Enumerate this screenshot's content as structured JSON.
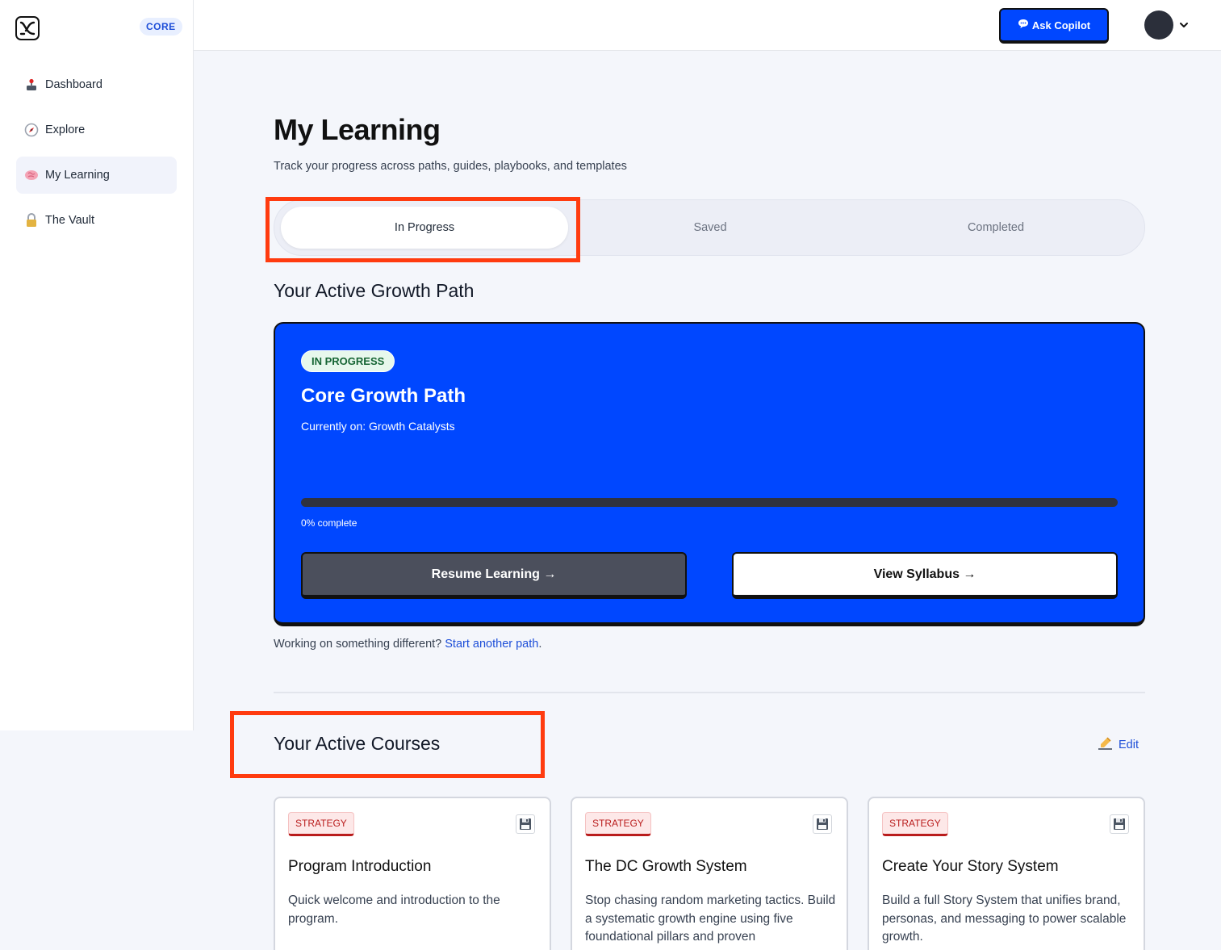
{
  "app": {
    "plan_badge": "CORE"
  },
  "sidebar": {
    "items": [
      {
        "label": "Dashboard",
        "icon": "joystick-icon"
      },
      {
        "label": "Explore",
        "icon": "compass-icon"
      },
      {
        "label": "My Learning",
        "icon": "brain-icon",
        "active": true
      },
      {
        "label": "The Vault",
        "icon": "lock-icon"
      }
    ]
  },
  "topbar": {
    "copilot_label": "Ask Copilot",
    "copilot_icon": "speech-bubble-icon"
  },
  "page": {
    "title": "My Learning",
    "subtitle": "Track your progress across paths, guides, playbooks, and templates"
  },
  "tabs": [
    {
      "label": "In Progress",
      "active": true
    },
    {
      "label": "Saved",
      "active": false
    },
    {
      "label": "Completed",
      "active": false
    }
  ],
  "growth_path": {
    "section_title": "Your Active Growth Path",
    "status": "IN PROGRESS",
    "title": "Core Growth Path",
    "currently_on": "Currently on: Growth Catalysts",
    "progress_percent": 0,
    "progress_label": "0% complete",
    "resume_label": "Resume Learning →",
    "syllabus_label": "View Syllabus →",
    "accent_color": "#0047ff"
  },
  "alt_path": {
    "prefix": "Working on something different?",
    "link": "Start another path",
    "suffix": "."
  },
  "courses": {
    "section_title": "Your Active Courses",
    "edit_label": "Edit",
    "edit_icon": "writing-hand-icon",
    "items": [
      {
        "tag": "STRATEGY",
        "title": "Program Introduction",
        "description": "Quick welcome and introduction to the program."
      },
      {
        "tag": "STRATEGY",
        "title": "The DC Growth System",
        "description": "Stop chasing random marketing tactics. Build a systematic growth engine using five foundational pillars and proven"
      },
      {
        "tag": "STRATEGY",
        "title": "Create Your Story System",
        "description": "Build a full Story System that unifies brand, personas, and messaging to power scalable growth."
      }
    ]
  }
}
